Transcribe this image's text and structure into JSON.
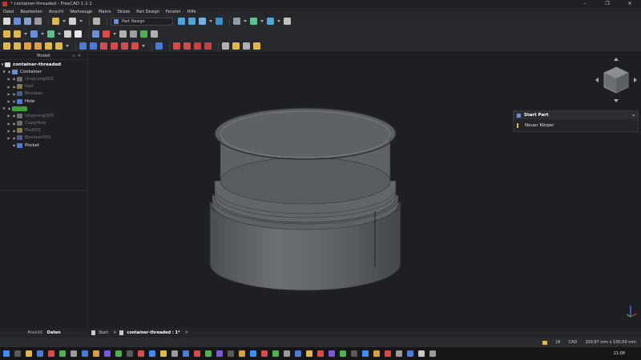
{
  "window": {
    "title": "* container-threaded - FreeCAD 1.1.1",
    "controls": [
      "–",
      "❐",
      "✕"
    ]
  },
  "menu": [
    "Datei",
    "Bearbeiten",
    "Ansicht",
    "Werkzeuge",
    "Makro",
    "Skizze",
    "Part Design",
    "Fenster",
    "Hilfe"
  ],
  "toolbar": {
    "workbench": "Part Design"
  },
  "panel": {
    "title": "Modell"
  },
  "tree": {
    "document": "container-threaded",
    "body1": "Container",
    "body1_children": [
      "Ursprung001",
      "Pad",
      "Boolean",
      "Hole"
    ],
    "body2_children": [
      "Ursprung003",
      "CopyHole",
      "Pad001",
      "Boolean001",
      "Pocket"
    ]
  },
  "left_tabs": [
    "Ansicht",
    "Daten"
  ],
  "doc_tabs": [
    {
      "label": "Start"
    },
    {
      "label": "container-threaded : 1*"
    }
  ],
  "task_panel": {
    "title": "Start Part",
    "item": "Neuer Körper"
  },
  "status": {
    "nav": "CAD",
    "dimensions": "200,97 mm x 100,00 mm",
    "zoom": "16"
  },
  "taskbar": {
    "clock": "21:08"
  },
  "colors": {
    "active_body": "#3aa135",
    "model": "#5c6063",
    "background": "#1e1f22"
  }
}
